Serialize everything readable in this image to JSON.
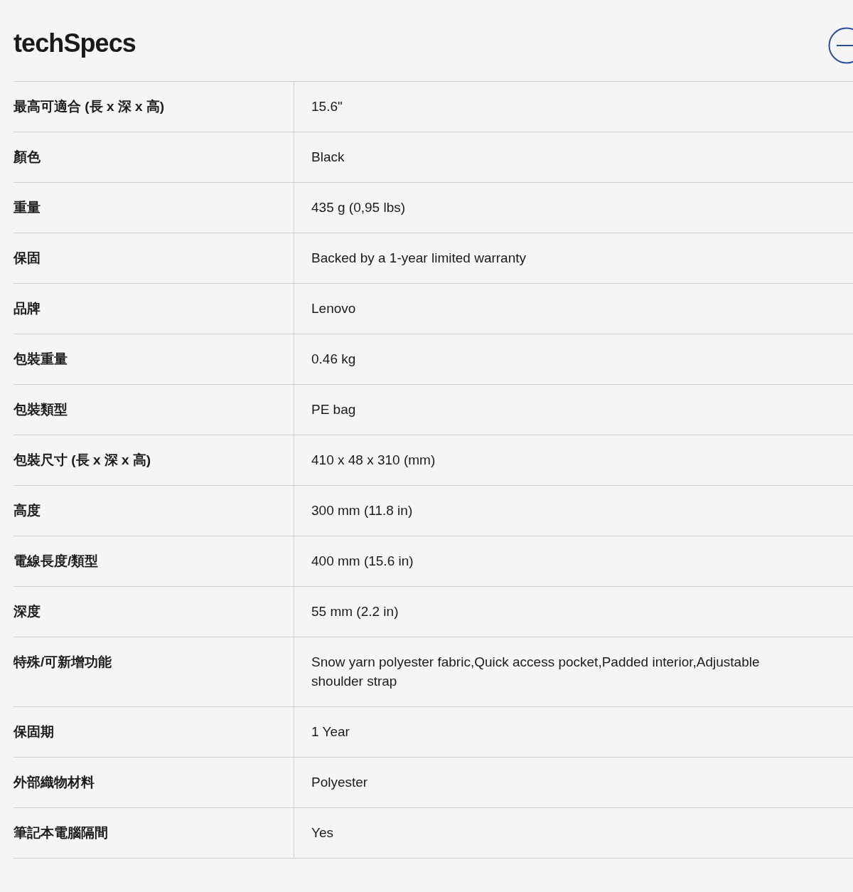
{
  "title": "techSpecs",
  "specs": [
    {
      "label": "最高可適合 (長 x 深 x 高)",
      "value": "15.6\""
    },
    {
      "label": "顏色",
      "value": "Black"
    },
    {
      "label": "重量",
      "value": "435 g (0,95 lbs)"
    },
    {
      "label": "保固",
      "value": "Backed by a 1-year limited warranty"
    },
    {
      "label": "品牌",
      "value": "Lenovo"
    },
    {
      "label": "包裝重量",
      "value": "0.46  kg"
    },
    {
      "label": "包裝類型",
      "value": "PE bag"
    },
    {
      "label": "包裝尺寸 (長 x 深 x 高)",
      "value": "410 x 48 x 310 (mm)"
    },
    {
      "label": "高度",
      "value": "300 mm (11.8 in)"
    },
    {
      "label": "電線長度/類型",
      "value": "400 mm (15.6 in)"
    },
    {
      "label": "深度",
      "value": "55 mm (2.2 in)"
    },
    {
      "label": "特殊/可新增功能",
      "value": "Snow yarn polyester fabric,Quick access pocket,Padded interior,Adjustable shoulder strap"
    },
    {
      "label": "保固期",
      "value": "1 Year"
    },
    {
      "label": "外部織物材料",
      "value": "Polyester"
    },
    {
      "label": "筆記本電腦隔間",
      "value": "Yes"
    }
  ]
}
